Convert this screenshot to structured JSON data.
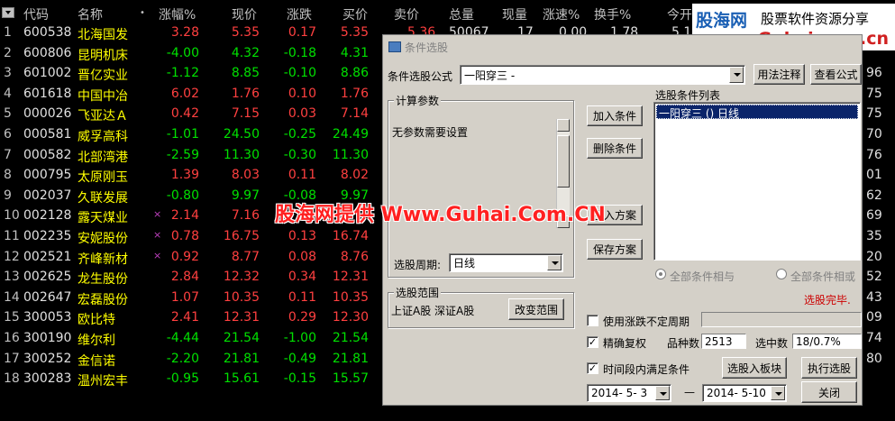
{
  "table": {
    "headers": [
      "代码",
      "名称",
      "•",
      "涨幅%",
      "现价",
      "涨跌",
      "买价",
      "卖价",
      "总量",
      "现量",
      "涨速%",
      "换手%",
      "今开"
    ],
    "right_col_values": [
      "",
      "",
      "",
      "96",
      "75",
      "75",
      "70",
      "76",
      "01",
      "62",
      "69",
      "35",
      "20",
      "52",
      "43",
      "09",
      "74",
      "80",
      ""
    ],
    "rows": [
      {
        "idx": "1",
        "code": "600538",
        "name": "北海国发",
        "mark": "",
        "pct": "3.28",
        "price": "5.35",
        "chg": "0.17",
        "bid": "5.35",
        "color": "red"
      },
      {
        "idx": "2",
        "code": "600806",
        "name": "昆明机床",
        "mark": "",
        "pct": "-4.00",
        "price": "4.32",
        "chg": "-0.18",
        "bid": "4.31",
        "color": "grn"
      },
      {
        "idx": "3",
        "code": "601002",
        "name": "晋亿实业",
        "mark": "",
        "pct": "-1.12",
        "price": "8.85",
        "chg": "-0.10",
        "bid": "8.86",
        "color": "grn"
      },
      {
        "idx": "4",
        "code": "601618",
        "name": "中国中冶",
        "mark": "",
        "pct": "6.02",
        "price": "1.76",
        "chg": "0.10",
        "bid": "1.76",
        "color": "red"
      },
      {
        "idx": "5",
        "code": "000026",
        "name": "飞亚达Ａ",
        "mark": "",
        "pct": "0.42",
        "price": "7.15",
        "chg": "0.03",
        "bid": "7.14",
        "color": "red"
      },
      {
        "idx": "6",
        "code": "000581",
        "name": "威孚高科",
        "mark": "",
        "pct": "-1.01",
        "price": "24.50",
        "chg": "-0.25",
        "bid": "24.49",
        "color": "grn"
      },
      {
        "idx": "7",
        "code": "000582",
        "name": "北部湾港",
        "mark": "",
        "pct": "-2.59",
        "price": "11.30",
        "chg": "-0.30",
        "bid": "11.30",
        "color": "grn"
      },
      {
        "idx": "8",
        "code": "000795",
        "name": "太原刚玉",
        "mark": "",
        "pct": "1.39",
        "price": "8.03",
        "chg": "0.11",
        "bid": "8.02",
        "color": "red"
      },
      {
        "idx": "9",
        "code": "002037",
        "name": "久联发展",
        "mark": "",
        "pct": "-0.80",
        "price": "9.97",
        "chg": "-0.08",
        "bid": "9.97",
        "color": "grn"
      },
      {
        "idx": "10",
        "code": "002128",
        "name": "露天煤业",
        "mark": "×",
        "pct": "2.14",
        "price": "7.16",
        "chg": "",
        "bid": "",
        "color": "red"
      },
      {
        "idx": "11",
        "code": "002235",
        "name": "安妮股份",
        "mark": "×",
        "pct": "0.78",
        "price": "16.75",
        "chg": "0.13",
        "bid": "16.74",
        "color": "red"
      },
      {
        "idx": "12",
        "code": "002521",
        "name": "齐峰新材",
        "mark": "×",
        "pct": "0.92",
        "price": "8.77",
        "chg": "0.08",
        "bid": "8.76",
        "color": "red"
      },
      {
        "idx": "13",
        "code": "002625",
        "name": "龙生股份",
        "mark": "",
        "pct": "2.84",
        "price": "12.32",
        "chg": "0.34",
        "bid": "12.31",
        "color": "red"
      },
      {
        "idx": "14",
        "code": "002647",
        "name": "宏磊股份",
        "mark": "",
        "pct": "1.07",
        "price": "10.35",
        "chg": "0.11",
        "bid": "10.35",
        "color": "red"
      },
      {
        "idx": "15",
        "code": "300053",
        "name": "欧比特",
        "mark": "",
        "pct": "2.41",
        "price": "12.31",
        "chg": "0.29",
        "bid": "12.30",
        "color": "red"
      },
      {
        "idx": "16",
        "code": "300190",
        "name": "维尔利",
        "mark": "",
        "pct": "-4.44",
        "price": "21.54",
        "chg": "-1.00",
        "bid": "21.54",
        "color": "grn"
      },
      {
        "idx": "17",
        "code": "300252",
        "name": "金信诺",
        "mark": "",
        "pct": "-2.20",
        "price": "21.81",
        "chg": "-0.49",
        "bid": "21.81",
        "color": "grn"
      },
      {
        "idx": "18",
        "code": "300283",
        "name": "温州宏丰",
        "mark": "",
        "pct": "-0.95",
        "price": "15.61",
        "chg": "-0.15",
        "bid": "15.57",
        "color": "grn"
      }
    ],
    "row1_extra": {
      "ask": "5.36",
      "vol": "50067",
      "cur": "17",
      "speed": "0.00",
      "turn": "1.78",
      "open": "5.1"
    }
  },
  "dialog": {
    "title": "条件选股",
    "formula_label": "条件选股公式",
    "formula_value": "一阳穿三 -",
    "usage_button": "用法注释",
    "view_formula_button": "查看公式",
    "params_group": "计算参数",
    "params_text": "无参数需要设置",
    "add_condition_button": "加入条件",
    "delete_condition_button": "删除条件",
    "import_plan_button": "引入方案",
    "save_plan_button": "保存方案",
    "conditions_list_label": "选股条件列表",
    "conditions": [
      "一阳穿三 () 日线"
    ],
    "period_label": "选股周期:",
    "period_value": "日线",
    "radio_all_and": "全部条件相与",
    "radio_all_or": "全部条件相或",
    "status_text": "选股完毕.",
    "range_group": "选股范围",
    "range_text": "上证A股 深证A股",
    "change_range_button": "改变范围",
    "use_unfixed_period": "使用涨跌不定周期",
    "precise_restore": "精确复权",
    "count_label": "品种数",
    "count_value": "2513",
    "selected_label": "选中数",
    "selected_value": "18/0.7%",
    "time_range_label": "时间段内满足条件",
    "add_to_block_button": "选股入板块",
    "execute_button": "执行选股",
    "date_from": "2014- 5- 3",
    "date_sep": "—",
    "date_to": "2014- 5-10",
    "close_button": "关闭"
  },
  "watermarks": {
    "top_brand": "股海网",
    "top_tagline": "股票软件资源分享",
    "top_url": "www.Guhai.com.cn",
    "center": "股海网提供 Www.Guhai.Com.CN"
  },
  "colors": {
    "up": "#ff4040",
    "down": "#00e000",
    "name": "#ffff00",
    "selected": "#0a246a",
    "status": "#cc0000"
  }
}
